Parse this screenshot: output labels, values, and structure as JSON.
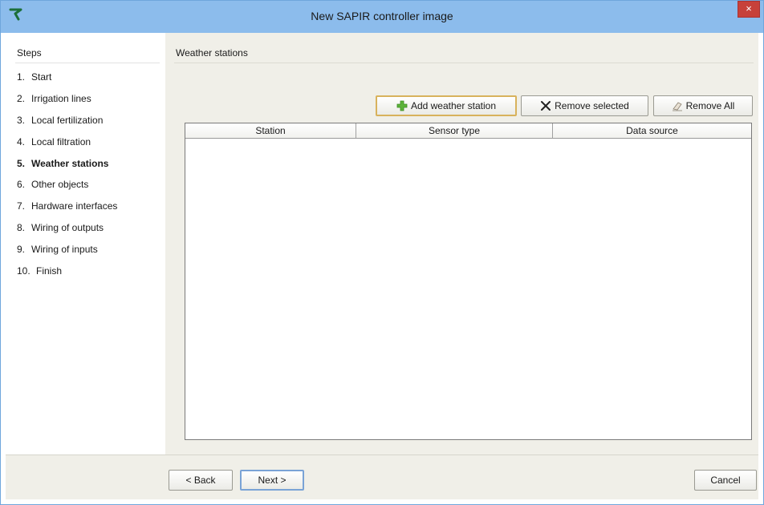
{
  "window": {
    "title": "New SAPIR controller image",
    "close_label": "×"
  },
  "sidebar": {
    "title": "Steps",
    "steps": [
      {
        "num": "1.",
        "label": "Start"
      },
      {
        "num": "2.",
        "label": "Irrigation lines"
      },
      {
        "num": "3.",
        "label": "Local fertilization"
      },
      {
        "num": "4.",
        "label": "Local filtration"
      },
      {
        "num": "5.",
        "label": "Weather stations"
      },
      {
        "num": "6.",
        "label": "Other objects"
      },
      {
        "num": "7.",
        "label": "Hardware interfaces"
      },
      {
        "num": "8.",
        "label": "Wiring of outputs"
      },
      {
        "num": "9.",
        "label": "Wiring of inputs"
      },
      {
        "num": "10.",
        "label": "Finish"
      }
    ],
    "active_step": 5
  },
  "main": {
    "title": "Weather stations",
    "toolbar": {
      "add_label": "Add weather station",
      "remove_selected_label": "Remove selected",
      "remove_all_label": "Remove All"
    },
    "table": {
      "columns": [
        "Station",
        "Sensor type",
        "Data source"
      ],
      "rows": []
    }
  },
  "footer": {
    "back_label": "< Back",
    "next_label": "Next >",
    "cancel_label": "Cancel"
  },
  "colors": {
    "titlebar": "#8cbcec",
    "close": "#c7413a",
    "accent_add": "#d8b25c",
    "plus_icon": "#5cb33a"
  }
}
